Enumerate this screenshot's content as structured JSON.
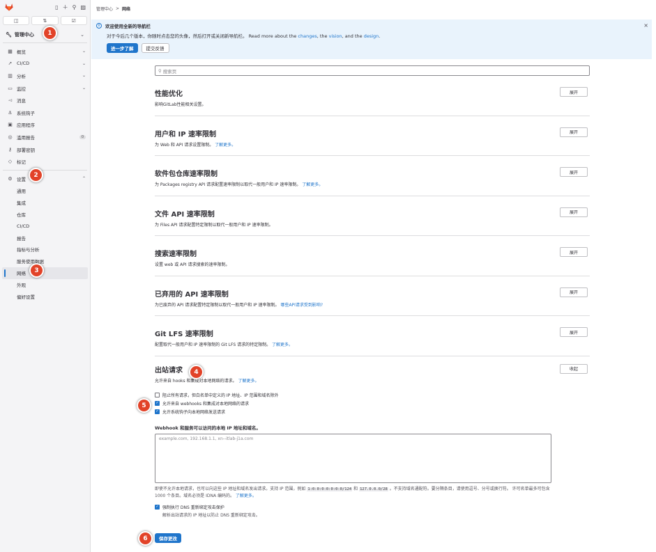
{
  "sidebar": {
    "top_icons": [
      "panel-icon",
      "plus-icon",
      "search-icon",
      "avatar"
    ],
    "tabs": [
      {
        "icon": "issues-icon"
      },
      {
        "icon": "merge-request-icon"
      },
      {
        "icon": "todo-icon"
      }
    ],
    "context": "管理中心",
    "items": [
      {
        "label": "概览",
        "icon": "grid-icon",
        "right": "⌄"
      },
      {
        "label": "CI/CD",
        "icon": "rocket-icon",
        "right": "⌄"
      },
      {
        "label": "分析",
        "icon": "chart-icon",
        "right": "⌄"
      },
      {
        "label": "监控",
        "icon": "monitor-icon",
        "right": "⌄"
      },
      {
        "label": "消息",
        "icon": "bullhorn-icon",
        "right": ""
      },
      {
        "label": "系统钩子",
        "icon": "hook-icon",
        "right": ""
      },
      {
        "label": "应用程序",
        "icon": "apps-icon",
        "right": ""
      },
      {
        "label": "滥用报告",
        "icon": "warning-icon",
        "badge": "0"
      },
      {
        "label": "部署密钥",
        "icon": "key-icon",
        "right": ""
      },
      {
        "label": "标记",
        "icon": "label-icon",
        "right": ""
      }
    ],
    "settings": {
      "label": "设置",
      "icon": "gear-icon",
      "right": "⌃"
    },
    "sub_items": [
      "通用",
      "集成",
      "仓库",
      "CI/CD",
      "报告",
      "指标与分析",
      "服务使用数据",
      "网络",
      "外观",
      "偏好设置"
    ],
    "active_sub": "网络"
  },
  "breadcrumb": {
    "parent": "管理中心",
    "sep": ">",
    "current": "网络"
  },
  "banner": {
    "title": "欢迎使用全新的导航栏",
    "desc_prefix": "对于今后几个版本，你随时点击您的头像，然后打开或关闭新导航栏。 Read more about the ",
    "link1": "changes",
    "mid1": ", the ",
    "link2": "vision",
    "mid2": ", and the ",
    "link3": "design",
    "end": ".",
    "primary_btn": "进一步了解",
    "secondary_btn": "提交反馈",
    "close": "×"
  },
  "search": {
    "placeholder": "搜索页"
  },
  "sections": [
    {
      "title": "性能优化",
      "desc": "影响GitLab性能相关设置。",
      "link": "",
      "button": "展开"
    },
    {
      "title": "用户和 IP 速率限制",
      "desc": "为 Web 和 API 请求设置限制。",
      "link": "了解更多。",
      "button": "展开"
    },
    {
      "title": "软件包仓库速率限制",
      "desc": "为 Packages registry API 请求配置速率限制以取代一般用户和 IP 速率限制。",
      "link": "了解更多。",
      "button": "展开"
    },
    {
      "title": "文件 API 速率限制",
      "desc": "为 Files API 请求配置特定限制以取代一般用户和 IP 速率限制。",
      "link": "",
      "button": "展开"
    },
    {
      "title": "搜索速率限制",
      "desc": "设置 web 或 API 请求搜索的速率限制。",
      "link": "",
      "button": "展开"
    },
    {
      "title": "已弃用的 API 速率限制",
      "desc": "为已废弃的 API 请求配置特定限制以取代一般用户和 IP 速率限制。",
      "link": "哪些API请求受到影响?",
      "button": "展开"
    },
    {
      "title": "Git LFS 速率限制",
      "desc": "配置取代一般用户和 IP 速率限制的 Git LFS 请求的特定限制。",
      "link": "了解更多。",
      "button": "展开"
    }
  ],
  "outbound": {
    "title": "出站请求",
    "button": "收起",
    "desc": "允许来自 hooks 和集成对本地网络的请求。",
    "link": "了解更多。",
    "checkboxes": [
      {
        "label": "阻止所有请求，但白名单中定义的 IP 地址、IP 范围和域名除外",
        "checked": false
      },
      {
        "label": "允许来自 webhooks 和集成对本地网络的请求",
        "checked": true
      },
      {
        "label": "允许系统钩子向本地网络发送请求",
        "checked": true
      }
    ],
    "webhook_label": "Webhook 和服务可以访问的本地 IP 地址和域名。",
    "textarea_placeholder": "example.com, 192.168.1.1, xn--itlab-j1a.com",
    "help_1": "即使不允许本地请求，也可以向这些 IP 地址和域名发出请求。支持 IP 范围，例如 ",
    "code_1": "1:0:0:0:0:0:0:0/124",
    "help_2": " 和 ",
    "code_2": "127.0.0.0/28",
    "help_3": " 。不支持域名通配符。要分隔条目，请使用逗号、分号或换行符。 许可名单最多可包含 1000 个条目。域名必须是 IDNA 编码的。",
    "help_link": "了解更多。",
    "dns_label": "强制执行 DNS 重新绑定攻击保护",
    "dns_checked": true,
    "dns_note": "解析出站请求的 IP 地址以防止 DNS 重新绑定攻击。"
  },
  "save_button": "保存更改",
  "steps": [
    "1",
    "2",
    "3",
    "4",
    "5",
    "6"
  ],
  "colors": {
    "primary": "#1f75cb",
    "step_badge": "#e24329",
    "banner_bg": "#e9f3fc",
    "sidebar_bg": "#f4f4f6"
  }
}
